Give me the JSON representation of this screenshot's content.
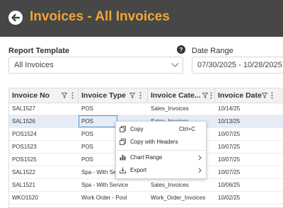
{
  "header": {
    "title": "Invoices - All Invoices"
  },
  "form": {
    "report_template_label": "Report Template",
    "report_template_value": "All Invoices",
    "date_range_label": "Date Range",
    "date_range_value": "07/30/2025 - 10/28/2025"
  },
  "grid": {
    "columns": [
      "Invoice No",
      "Invoice Type",
      "Invoice Cate...",
      "Invoice Date"
    ],
    "rows": [
      {
        "no": "SAL1527",
        "type": "POS",
        "cat": "Sales_Invoices",
        "date": "10/14/25"
      },
      {
        "no": "SAL1526",
        "type": "POS",
        "cat": "Sales_Invoices",
        "date": "10/13/25"
      },
      {
        "no": "POS1524",
        "type": "POS",
        "cat": "",
        "date": "10/07/25"
      },
      {
        "no": "POS1523",
        "type": "POS",
        "cat": "",
        "date": "10/07/25"
      },
      {
        "no": "POS1525",
        "type": "POS",
        "cat": "",
        "date": "10/07/25"
      },
      {
        "no": "SAL1522",
        "type": "Spa - With Service",
        "cat": "",
        "date": "10/07/25"
      },
      {
        "no": "SAL1521",
        "type": "Spa - With Service",
        "cat": "Sales_Invoices",
        "date": "10/06/25"
      },
      {
        "no": "WKO1520",
        "type": "Work Order - Pool",
        "cat": "Work_Order_Invoices",
        "date": "10/02/25"
      }
    ]
  },
  "context_menu": {
    "copy": "Copy",
    "copy_shortcut": "Ctrl+C",
    "copy_with_headers": "Copy with Headers",
    "chart_range": "Chart Range",
    "export": "Export"
  },
  "colors": {
    "accent": "#f2a531",
    "header_bg": "#474747",
    "selection": "#e5ecf6"
  }
}
